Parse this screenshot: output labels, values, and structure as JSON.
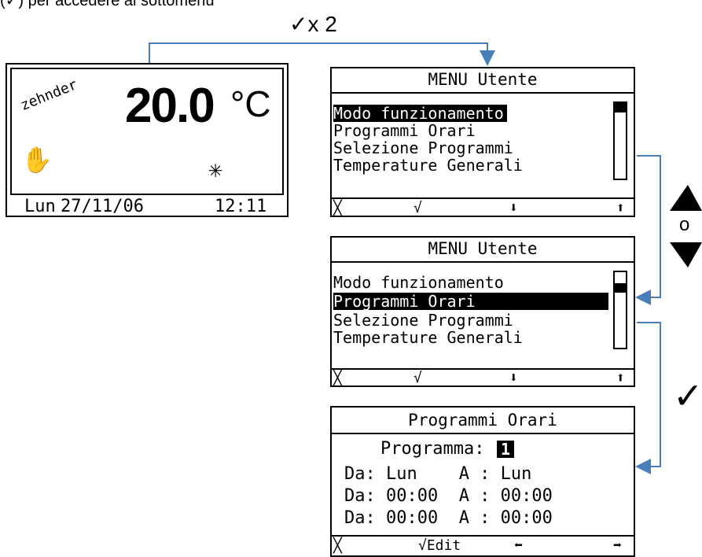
{
  "header_caption": "(✓) per accedere al sottomenù",
  "top_check_label": "✓x 2",
  "right_o_label": "o",
  "right_check_symbol": "✓",
  "main_display": {
    "brand": "zehnder",
    "temperature": "20.0",
    "unit": "°C",
    "day": "Lun",
    "date": "27/11/06",
    "time": "12:11",
    "hand_icon": "✋",
    "snow_icon": "✳"
  },
  "menu_screens": [
    {
      "title": "MENU Utente",
      "items": [
        "Modo funzionamento",
        "Programmi Orari",
        "Selezione Programmi",
        "Temperature Generali"
      ],
      "selected_index": 0,
      "footer": [
        "╳",
        "√",
        "⬇",
        "⬆"
      ]
    },
    {
      "title": "MENU Utente",
      "items": [
        "Modo funzionamento",
        "Programmi Orari",
        "Selezione Programmi",
        "Temperature Generali"
      ],
      "selected_index": 1,
      "footer": [
        "╳",
        "√",
        "⬇",
        "⬆"
      ]
    }
  ],
  "program_screen": {
    "title": "Programmi Orari",
    "program_label": "Programma:",
    "program_value": "1",
    "rows": [
      "Da: Lun    A : Lun",
      "Da: 00:00  A : 00:00",
      "Da: 00:00  A : 00:00"
    ],
    "footer": [
      "╳",
      "√Edit",
      "⬅",
      "➡"
    ]
  },
  "colors": {
    "arrow": "#4a7ebb"
  }
}
